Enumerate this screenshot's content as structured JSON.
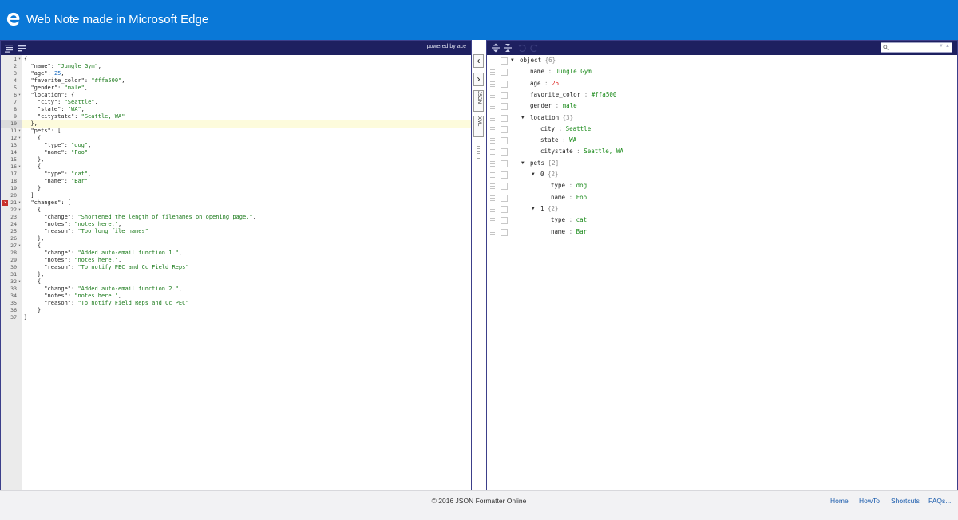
{
  "banner": {
    "title": "Web Note made in Microsoft Edge"
  },
  "editor": {
    "powered_by": "powered by ace",
    "active_line": 10,
    "error_line": 21,
    "lines": [
      {
        "n": 1,
        "fold": true,
        "tokens": [
          {
            "t": "p",
            "v": "{"
          }
        ]
      },
      {
        "n": 2,
        "tokens": [
          {
            "t": "p",
            "v": "  "
          },
          {
            "t": "key",
            "v": "\"name\""
          },
          {
            "t": "p",
            "v": ": "
          },
          {
            "t": "str",
            "v": "\"Jungle Gym\""
          },
          {
            "t": "p",
            "v": ","
          }
        ]
      },
      {
        "n": 3,
        "tokens": [
          {
            "t": "p",
            "v": "  "
          },
          {
            "t": "key",
            "v": "\"age\""
          },
          {
            "t": "p",
            "v": ": "
          },
          {
            "t": "num",
            "v": "25"
          },
          {
            "t": "p",
            "v": ","
          }
        ]
      },
      {
        "n": 4,
        "tokens": [
          {
            "t": "p",
            "v": "  "
          },
          {
            "t": "key",
            "v": "\"favorite_color\""
          },
          {
            "t": "p",
            "v": ": "
          },
          {
            "t": "str",
            "v": "\"#ffa500\""
          },
          {
            "t": "p",
            "v": ","
          }
        ]
      },
      {
        "n": 5,
        "tokens": [
          {
            "t": "p",
            "v": "  "
          },
          {
            "t": "key",
            "v": "\"gender\""
          },
          {
            "t": "p",
            "v": ": "
          },
          {
            "t": "str",
            "v": "\"male\""
          },
          {
            "t": "p",
            "v": ","
          }
        ]
      },
      {
        "n": 6,
        "fold": true,
        "tokens": [
          {
            "t": "p",
            "v": "  "
          },
          {
            "t": "key",
            "v": "\"location\""
          },
          {
            "t": "p",
            "v": ": {"
          }
        ]
      },
      {
        "n": 7,
        "tokens": [
          {
            "t": "p",
            "v": "    "
          },
          {
            "t": "key",
            "v": "\"city\""
          },
          {
            "t": "p",
            "v": ": "
          },
          {
            "t": "str",
            "v": "\"Seattle\""
          },
          {
            "t": "p",
            "v": ","
          }
        ]
      },
      {
        "n": 8,
        "tokens": [
          {
            "t": "p",
            "v": "    "
          },
          {
            "t": "key",
            "v": "\"state\""
          },
          {
            "t": "p",
            "v": ": "
          },
          {
            "t": "str",
            "v": "\"WA\""
          },
          {
            "t": "p",
            "v": ","
          }
        ]
      },
      {
        "n": 9,
        "tokens": [
          {
            "t": "p",
            "v": "    "
          },
          {
            "t": "key",
            "v": "\"citystate\""
          },
          {
            "t": "p",
            "v": ": "
          },
          {
            "t": "str",
            "v": "\"Seattle, WA\""
          }
        ]
      },
      {
        "n": 10,
        "tokens": [
          {
            "t": "p",
            "v": "  },"
          }
        ]
      },
      {
        "n": 11,
        "fold": true,
        "tokens": [
          {
            "t": "p",
            "v": "  "
          },
          {
            "t": "key",
            "v": "\"pets\""
          },
          {
            "t": "p",
            "v": ": ["
          }
        ]
      },
      {
        "n": 12,
        "fold": true,
        "tokens": [
          {
            "t": "p",
            "v": "    {"
          }
        ]
      },
      {
        "n": 13,
        "tokens": [
          {
            "t": "p",
            "v": "      "
          },
          {
            "t": "key",
            "v": "\"type\""
          },
          {
            "t": "p",
            "v": ": "
          },
          {
            "t": "str",
            "v": "\"dog\""
          },
          {
            "t": "p",
            "v": ","
          }
        ]
      },
      {
        "n": 14,
        "tokens": [
          {
            "t": "p",
            "v": "      "
          },
          {
            "t": "key",
            "v": "\"name\""
          },
          {
            "t": "p",
            "v": ": "
          },
          {
            "t": "str",
            "v": "\"Foo\""
          }
        ]
      },
      {
        "n": 15,
        "tokens": [
          {
            "t": "p",
            "v": "    },"
          }
        ]
      },
      {
        "n": 16,
        "fold": true,
        "tokens": [
          {
            "t": "p",
            "v": "    {"
          }
        ]
      },
      {
        "n": 17,
        "tokens": [
          {
            "t": "p",
            "v": "      "
          },
          {
            "t": "key",
            "v": "\"type\""
          },
          {
            "t": "p",
            "v": ": "
          },
          {
            "t": "str",
            "v": "\"cat\""
          },
          {
            "t": "p",
            "v": ","
          }
        ]
      },
      {
        "n": 18,
        "tokens": [
          {
            "t": "p",
            "v": "      "
          },
          {
            "t": "key",
            "v": "\"name\""
          },
          {
            "t": "p",
            "v": ": "
          },
          {
            "t": "str",
            "v": "\"Bar\""
          }
        ]
      },
      {
        "n": 19,
        "tokens": [
          {
            "t": "p",
            "v": "    }"
          }
        ]
      },
      {
        "n": 20,
        "tokens": [
          {
            "t": "p",
            "v": "  ]"
          }
        ]
      },
      {
        "n": 21,
        "fold": true,
        "tokens": [
          {
            "t": "p",
            "v": "  "
          },
          {
            "t": "key",
            "v": "\"changes\""
          },
          {
            "t": "p",
            "v": ": ["
          }
        ]
      },
      {
        "n": 22,
        "fold": true,
        "tokens": [
          {
            "t": "p",
            "v": "    {"
          }
        ]
      },
      {
        "n": 23,
        "tokens": [
          {
            "t": "p",
            "v": "      "
          },
          {
            "t": "key",
            "v": "\"change\""
          },
          {
            "t": "p",
            "v": ": "
          },
          {
            "t": "str",
            "v": "\"Shortened the length of filenames on opening page.\""
          },
          {
            "t": "p",
            "v": ","
          }
        ]
      },
      {
        "n": 24,
        "tokens": [
          {
            "t": "p",
            "v": "      "
          },
          {
            "t": "key",
            "v": "\"notes\""
          },
          {
            "t": "p",
            "v": ": "
          },
          {
            "t": "str",
            "v": "\"notes here.\""
          },
          {
            "t": "p",
            "v": ","
          }
        ]
      },
      {
        "n": 25,
        "tokens": [
          {
            "t": "p",
            "v": "      "
          },
          {
            "t": "key",
            "v": "\"reason\""
          },
          {
            "t": "p",
            "v": ": "
          },
          {
            "t": "str",
            "v": "\"Too long file names\""
          }
        ]
      },
      {
        "n": 26,
        "tokens": [
          {
            "t": "p",
            "v": "    },"
          }
        ]
      },
      {
        "n": 27,
        "fold": true,
        "tokens": [
          {
            "t": "p",
            "v": "    {"
          }
        ]
      },
      {
        "n": 28,
        "tokens": [
          {
            "t": "p",
            "v": "      "
          },
          {
            "t": "key",
            "v": "\"change\""
          },
          {
            "t": "p",
            "v": ": "
          },
          {
            "t": "str",
            "v": "\"Added auto-email function 1.\""
          },
          {
            "t": "p",
            "v": ","
          }
        ]
      },
      {
        "n": 29,
        "tokens": [
          {
            "t": "p",
            "v": "      "
          },
          {
            "t": "key",
            "v": "\"notes\""
          },
          {
            "t": "p",
            "v": ": "
          },
          {
            "t": "str",
            "v": "\"notes here.\""
          },
          {
            "t": "p",
            "v": ","
          }
        ]
      },
      {
        "n": 30,
        "tokens": [
          {
            "t": "p",
            "v": "      "
          },
          {
            "t": "key",
            "v": "\"reason\""
          },
          {
            "t": "p",
            "v": ": "
          },
          {
            "t": "str",
            "v": "\"To notify PEC and Cc Field Reps\""
          }
        ]
      },
      {
        "n": 31,
        "tokens": [
          {
            "t": "p",
            "v": "    },"
          }
        ]
      },
      {
        "n": 32,
        "fold": true,
        "tokens": [
          {
            "t": "p",
            "v": "    {"
          }
        ]
      },
      {
        "n": 33,
        "tokens": [
          {
            "t": "p",
            "v": "      "
          },
          {
            "t": "key",
            "v": "\"change\""
          },
          {
            "t": "p",
            "v": ": "
          },
          {
            "t": "str",
            "v": "\"Added auto-email function 2.\""
          },
          {
            "t": "p",
            "v": ","
          }
        ]
      },
      {
        "n": 34,
        "tokens": [
          {
            "t": "p",
            "v": "      "
          },
          {
            "t": "key",
            "v": "\"notes\""
          },
          {
            "t": "p",
            "v": ": "
          },
          {
            "t": "str",
            "v": "\"notes here.\""
          },
          {
            "t": "p",
            "v": ","
          }
        ]
      },
      {
        "n": 35,
        "tokens": [
          {
            "t": "p",
            "v": "      "
          },
          {
            "t": "key",
            "v": "\"reason\""
          },
          {
            "t": "p",
            "v": ": "
          },
          {
            "t": "str",
            "v": "\"To notify Field Reps and Cc PEC\""
          }
        ]
      },
      {
        "n": 36,
        "tokens": [
          {
            "t": "p",
            "v": "    }"
          }
        ]
      },
      {
        "n": 37,
        "tokens": [
          {
            "t": "p",
            "v": "}"
          }
        ]
      }
    ]
  },
  "middle": {
    "copy_left_icon": "‹",
    "copy_right_icon": "›",
    "json_button": "JSON",
    "xml_button": "XML"
  },
  "tree": {
    "search": {
      "placeholder": ""
    },
    "rows": [
      {
        "depth": 0,
        "toggle": "expanded",
        "field": "object",
        "count": "{6}",
        "hasContext": true,
        "noDrag": true
      },
      {
        "depth": 1,
        "field": "name",
        "value": "Jungle Gym",
        "vtype": "str"
      },
      {
        "depth": 1,
        "field": "age",
        "value": "25",
        "vtype": "num"
      },
      {
        "depth": 1,
        "field": "favorite_color",
        "value": "#ffa500",
        "vtype": "str"
      },
      {
        "depth": 1,
        "field": "gender",
        "value": "male",
        "vtype": "str"
      },
      {
        "depth": 1,
        "toggle": "expanded",
        "field": "location",
        "count": "{3}"
      },
      {
        "depth": 2,
        "field": "city",
        "value": "Seattle",
        "vtype": "str"
      },
      {
        "depth": 2,
        "field": "state",
        "value": "WA",
        "vtype": "str"
      },
      {
        "depth": 2,
        "field": "citystate",
        "value": "Seattle, WA",
        "vtype": "str"
      },
      {
        "depth": 1,
        "toggle": "expanded",
        "field": "pets",
        "count": "[2]"
      },
      {
        "depth": 2,
        "toggle": "expanded",
        "field": "0",
        "count": "{2}"
      },
      {
        "depth": 3,
        "field": "type",
        "value": "dog",
        "vtype": "str"
      },
      {
        "depth": 3,
        "field": "name",
        "value": "Foo",
        "vtype": "str"
      },
      {
        "depth": 2,
        "toggle": "expanded",
        "field": "1",
        "count": "{2}"
      },
      {
        "depth": 3,
        "field": "type",
        "value": "cat",
        "vtype": "str"
      },
      {
        "depth": 3,
        "field": "name",
        "value": "Bar",
        "vtype": "str"
      }
    ]
  },
  "footer": {
    "copyright": "© 2016 JSON Formatter Online",
    "links": [
      "Home",
      "HowTo",
      "Shortcuts",
      "FAQs...."
    ]
  },
  "colors": {
    "banner": "#0a78d7",
    "menubar": "#1e2060",
    "string": "#1a7a1a",
    "number": "#e0302c"
  }
}
